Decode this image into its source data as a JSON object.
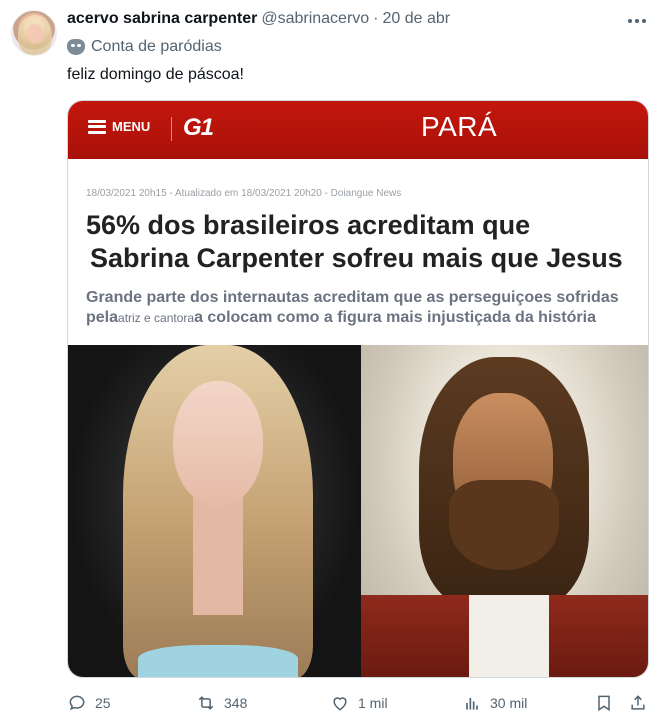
{
  "post": {
    "display_name": "acervo sabrina carpenter",
    "handle": "@sabrinacervo",
    "separator": "·",
    "date": "20 de abr",
    "label": "Conta de paródias",
    "text": "feliz domingo de páscoa!"
  },
  "media": {
    "menu": "MENU",
    "brand": "G1",
    "region": "PARÁ",
    "byline": "18/03/2021 20h15 - Atualizado em 18/03/2021 20h20 - Doiangue News",
    "headline_line1": "56% dos brasileiros acreditam que",
    "headline_line2": "Sabrina Carpenter sofreu mais que Jesus",
    "sub_part1": "Grande parte dos internautas acreditam que as perseguiçoes sofridas",
    "sub_part2": "pela",
    "sub_small": "atriz e cantora",
    "sub_part3": "a colocam como a figura mais injustiçada da história"
  },
  "actions": {
    "replies": "25",
    "reposts": "348",
    "likes": "1 mil",
    "views": "30 mil"
  },
  "icons": [
    "more-icon",
    "parody-mask-icon",
    "reply-icon",
    "repost-icon",
    "like-icon",
    "views-icon",
    "bookmark-icon",
    "share-icon"
  ],
  "colors": {
    "g1_red": "#c4170c",
    "secondary_text": "#536471"
  }
}
